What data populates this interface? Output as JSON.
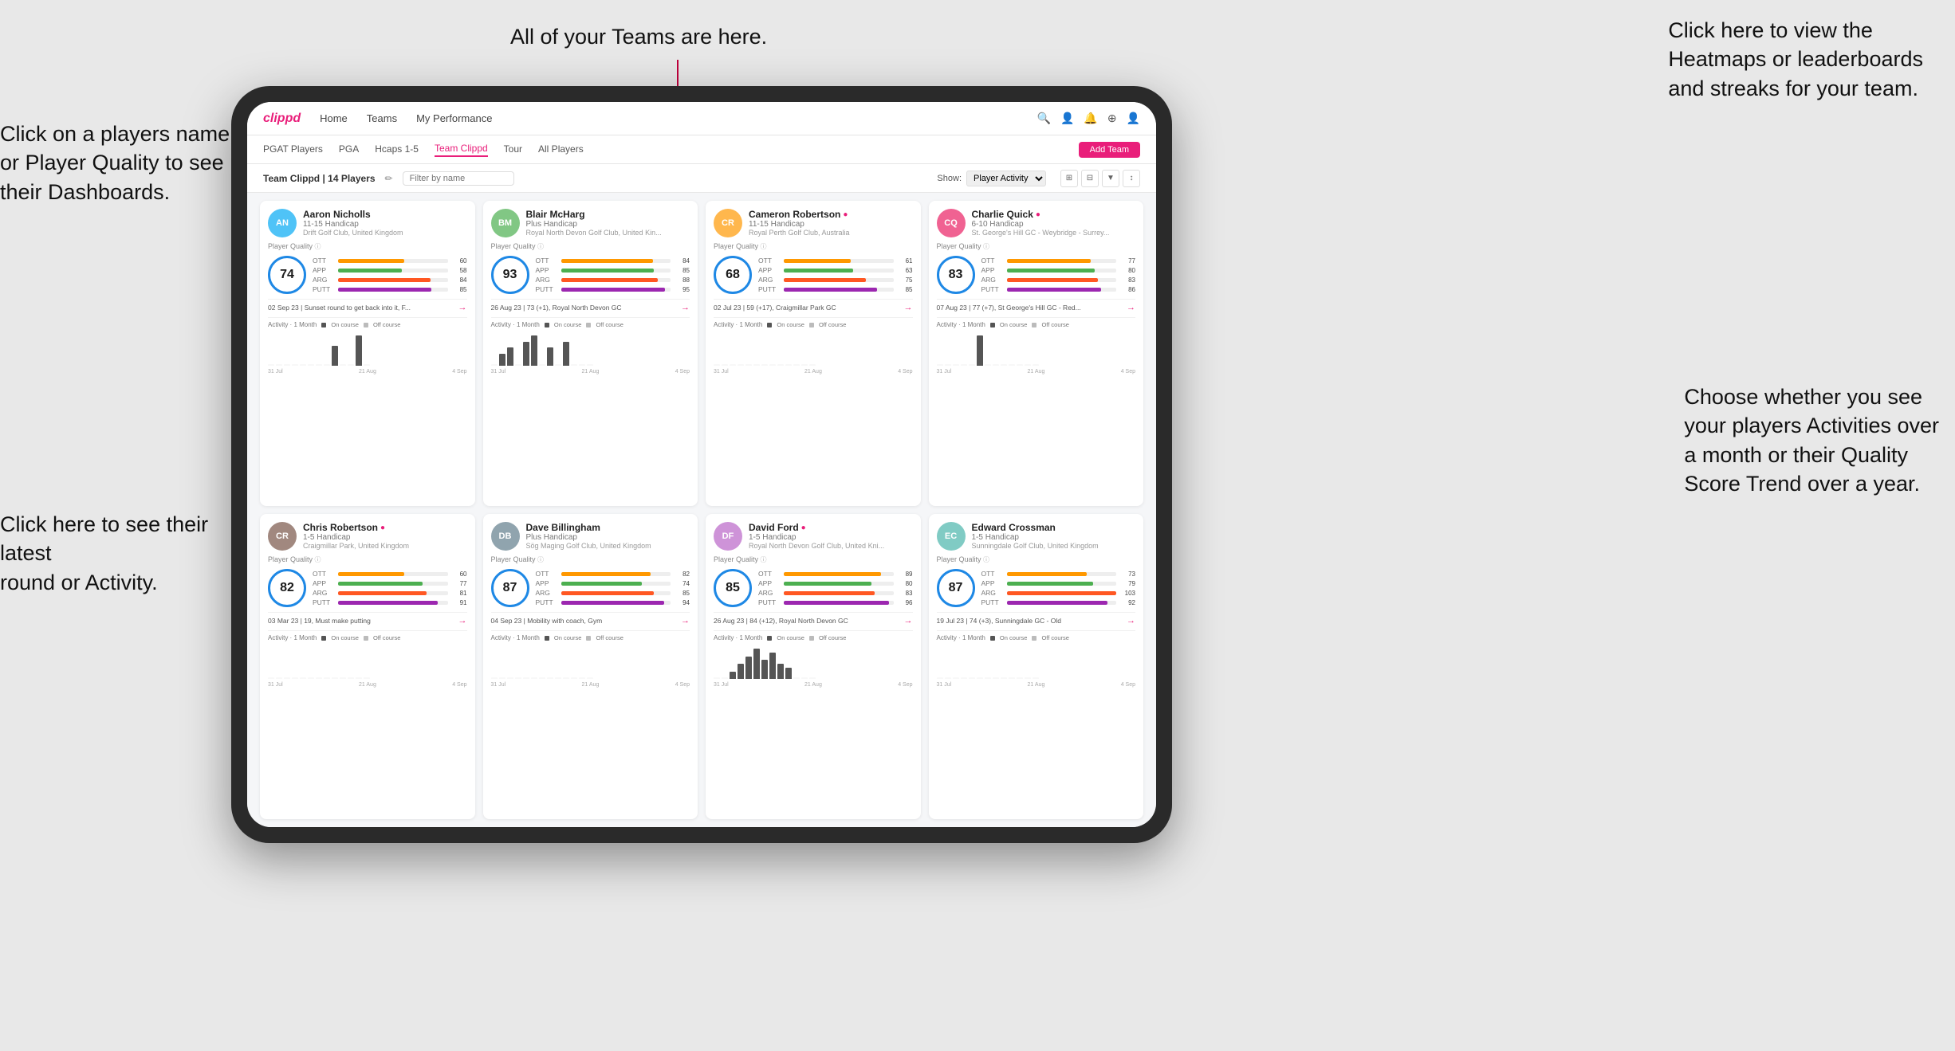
{
  "annotations": {
    "top_teams": "All of your Teams are here.",
    "top_right": "Click here to view the\nHeatmaps or leaderboards\nand streaks for your team.",
    "left_top": "Click on a players name\nor Player Quality to see\ntheir Dashboards.",
    "left_bottom": "Click here to see their latest\nround or Activity.",
    "right_bottom": "Choose whether you see\nyour players Activities over\na month or their Quality\nScore Trend over a year."
  },
  "nav": {
    "logo": "clippd",
    "items": [
      "Home",
      "Teams",
      "My Performance"
    ],
    "icons": [
      "🔍",
      "👤",
      "🔔",
      "⊕",
      "👤"
    ]
  },
  "sub_nav": {
    "items": [
      "PGAT Players",
      "PGA",
      "Hcaps 1-5",
      "Team Clippd",
      "Tour",
      "All Players"
    ],
    "active": "Team Clippd",
    "add_btn": "Add Team"
  },
  "team_bar": {
    "title": "Team Clippd | 14 Players",
    "edit_icon": "✏",
    "search_placeholder": "Filter by name",
    "show_label": "Show:",
    "show_value": "Player Activity",
    "view_options": [
      "⊞",
      "⊟",
      "▼",
      "↕"
    ]
  },
  "players": [
    {
      "name": "Aaron Nicholls",
      "hcp": "11-15 Handicap",
      "club": "Drift Golf Club, United Kingdom",
      "quality": 74,
      "quality_color": "#1e88e5",
      "stats": {
        "ott": {
          "value": 60,
          "pct": 60
        },
        "app": {
          "value": 58,
          "pct": 58
        },
        "arg": {
          "value": 84,
          "pct": 84
        },
        "putt": {
          "value": 85,
          "pct": 85
        }
      },
      "latest": "02 Sep 23 | Sunset round to get back into it, F...",
      "chart_bars": [
        0,
        0,
        0,
        0,
        0,
        0,
        0,
        0,
        2,
        0,
        0,
        3,
        0
      ],
      "chart_labels": [
        "31 Jul",
        "21 Aug",
        "4 Sep"
      ],
      "verified": false
    },
    {
      "name": "Blair McHarg",
      "hcp": "Plus Handicap",
      "club": "Royal North Devon Golf Club, United Kin...",
      "quality": 93,
      "quality_color": "#1e88e5",
      "stats": {
        "ott": {
          "value": 84,
          "pct": 84
        },
        "app": {
          "value": 85,
          "pct": 85
        },
        "arg": {
          "value": 88,
          "pct": 88
        },
        "putt": {
          "value": 95,
          "pct": 95
        }
      },
      "latest": "26 Aug 23 | 73 (+1), Royal North Devon GC",
      "chart_bars": [
        0,
        2,
        3,
        0,
        4,
        5,
        0,
        3,
        0,
        4,
        0,
        0,
        0
      ],
      "chart_labels": [
        "31 Jul",
        "21 Aug",
        "4 Sep"
      ],
      "verified": false
    },
    {
      "name": "Cameron Robertson",
      "hcp": "11-15 Handicap",
      "club": "Royal Perth Golf Club, Australia",
      "quality": 68,
      "quality_color": "#1e88e5",
      "stats": {
        "ott": {
          "value": 61,
          "pct": 61
        },
        "app": {
          "value": 63,
          "pct": 63
        },
        "arg": {
          "value": 75,
          "pct": 75
        },
        "putt": {
          "value": 85,
          "pct": 85
        }
      },
      "latest": "02 Jul 23 | 59 (+17), Craigmillar Park GC",
      "chart_bars": [
        0,
        0,
        0,
        0,
        0,
        0,
        0,
        0,
        0,
        0,
        0,
        0,
        0
      ],
      "chart_labels": [
        "31 Jul",
        "21 Aug",
        "4 Sep"
      ],
      "verified": true
    },
    {
      "name": "Charlie Quick",
      "hcp": "6-10 Handicap",
      "club": "St. George's Hill GC - Weybridge - Surrey...",
      "quality": 83,
      "quality_color": "#1e88e5",
      "stats": {
        "ott": {
          "value": 77,
          "pct": 77
        },
        "app": {
          "value": 80,
          "pct": 80
        },
        "arg": {
          "value": 83,
          "pct": 83
        },
        "putt": {
          "value": 86,
          "pct": 86
        }
      },
      "latest": "07 Aug 23 | 77 (+7), St George's Hill GC - Red...",
      "chart_bars": [
        0,
        0,
        0,
        0,
        0,
        3,
        0,
        0,
        0,
        0,
        0,
        0,
        0
      ],
      "chart_labels": [
        "31 Jul",
        "21 Aug",
        "4 Sep"
      ],
      "verified": true
    },
    {
      "name": "Chris Robertson",
      "hcp": "1-5 Handicap",
      "club": "Craigmillar Park, United Kingdom",
      "quality": 82,
      "quality_color": "#1e88e5",
      "stats": {
        "ott": {
          "value": 60,
          "pct": 60
        },
        "app": {
          "value": 77,
          "pct": 77
        },
        "arg": {
          "value": 81,
          "pct": 81
        },
        "putt": {
          "value": 91,
          "pct": 91
        }
      },
      "latest": "03 Mar 23 | 19, Must make putting",
      "chart_bars": [
        0,
        0,
        0,
        0,
        0,
        0,
        0,
        0,
        0,
        0,
        0,
        0,
        0
      ],
      "chart_labels": [
        "31 Jul",
        "21 Aug",
        "4 Sep"
      ],
      "verified": true
    },
    {
      "name": "Dave Billingham",
      "hcp": "Plus Handicap",
      "club": "Sög Maging Golf Club, United Kingdom",
      "quality": 87,
      "quality_color": "#1e88e5",
      "stats": {
        "ott": {
          "value": 82,
          "pct": 82
        },
        "app": {
          "value": 74,
          "pct": 74
        },
        "arg": {
          "value": 85,
          "pct": 85
        },
        "putt": {
          "value": 94,
          "pct": 94
        }
      },
      "latest": "04 Sep 23 | Mobility with coach, Gym",
      "chart_bars": [
        0,
        0,
        0,
        0,
        0,
        0,
        0,
        0,
        0,
        0,
        0,
        0,
        0
      ],
      "chart_labels": [
        "31 Jul",
        "21 Aug",
        "4 Sep"
      ],
      "verified": false
    },
    {
      "name": "David Ford",
      "hcp": "1-5 Handicap",
      "club": "Royal North Devon Golf Club, United Kni...",
      "quality": 85,
      "quality_color": "#1e88e5",
      "stats": {
        "ott": {
          "value": 89,
          "pct": 89
        },
        "app": {
          "value": 80,
          "pct": 80
        },
        "arg": {
          "value": 83,
          "pct": 83
        },
        "putt": {
          "value": 96,
          "pct": 96
        }
      },
      "latest": "26 Aug 23 | 84 (+12), Royal North Devon GC",
      "chart_bars": [
        0,
        0,
        2,
        4,
        6,
        8,
        5,
        7,
        4,
        3,
        0,
        0,
        0
      ],
      "chart_labels": [
        "31 Jul",
        "21 Aug",
        "4 Sep"
      ],
      "verified": true
    },
    {
      "name": "Edward Crossman",
      "hcp": "1-5 Handicap",
      "club": "Sunningdale Golf Club, United Kingdom",
      "quality": 87,
      "quality_color": "#1e88e5",
      "stats": {
        "ott": {
          "value": 73,
          "pct": 73
        },
        "app": {
          "value": 79,
          "pct": 79
        },
        "arg": {
          "value": 103,
          "pct": 100
        },
        "putt": {
          "value": 92,
          "pct": 92
        }
      },
      "latest": "19 Jul 23 | 74 (+3), Sunningdale GC - Old",
      "chart_bars": [
        0,
        0,
        0,
        0,
        0,
        0,
        0,
        0,
        0,
        0,
        0,
        0,
        0
      ],
      "chart_labels": [
        "31 Jul",
        "21 Aug",
        "4 Sep"
      ],
      "verified": false
    }
  ],
  "chart_legend": {
    "on_course": "#555",
    "off_course": "#aaa",
    "on_label": "On course",
    "off_label": "Off course"
  }
}
